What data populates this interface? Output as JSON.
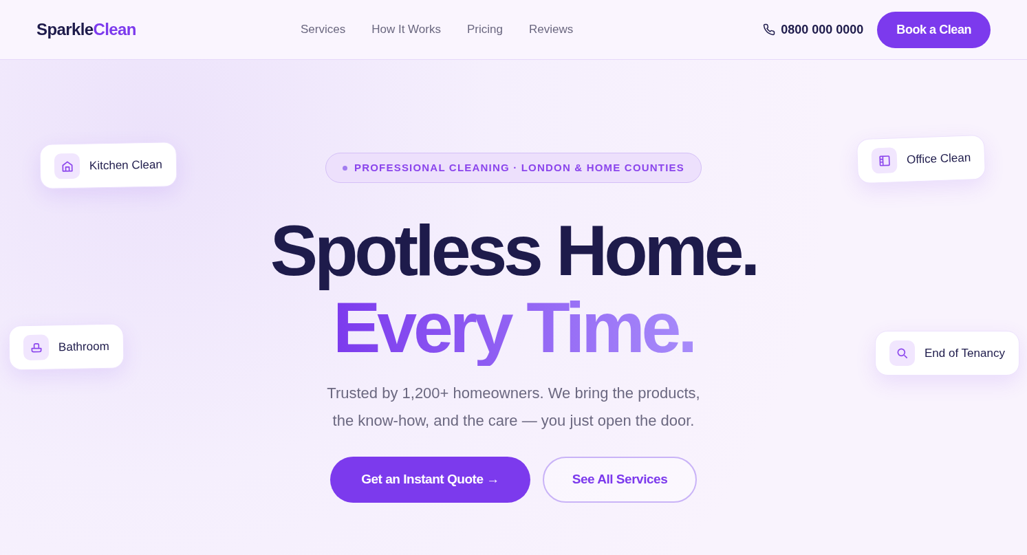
{
  "header": {
    "logo": [
      "Sparkle",
      "Clean"
    ],
    "nav": [
      "Services",
      "How It Works",
      "Pricing",
      "Reviews"
    ],
    "phone": "0800 000 0000",
    "cta": "Book a Clean"
  },
  "hero": {
    "badge": "PROFESSIONAL CLEANING · LONDON & HOME COUNTIES",
    "headline": [
      "Spotless Home.",
      "Every Time."
    ],
    "subtitle": [
      "Trusted by 1,200+ homeowners. We bring the products,",
      "the know-how, and the care — you just open the door."
    ],
    "buttons": [
      {
        "label": "Get an Instant Quote →",
        "kind": "primary"
      },
      {
        "label": "See All Services",
        "kind": "secondary"
      }
    ]
  },
  "floating_cards": [
    {
      "label": "Kitchen Clean",
      "kind": "home"
    },
    {
      "label": "Office Clean",
      "kind": "panel"
    },
    {
      "label": "Bathroom",
      "kind": "bath"
    },
    {
      "label": "End of Tenancy",
      "kind": "search"
    }
  ]
}
